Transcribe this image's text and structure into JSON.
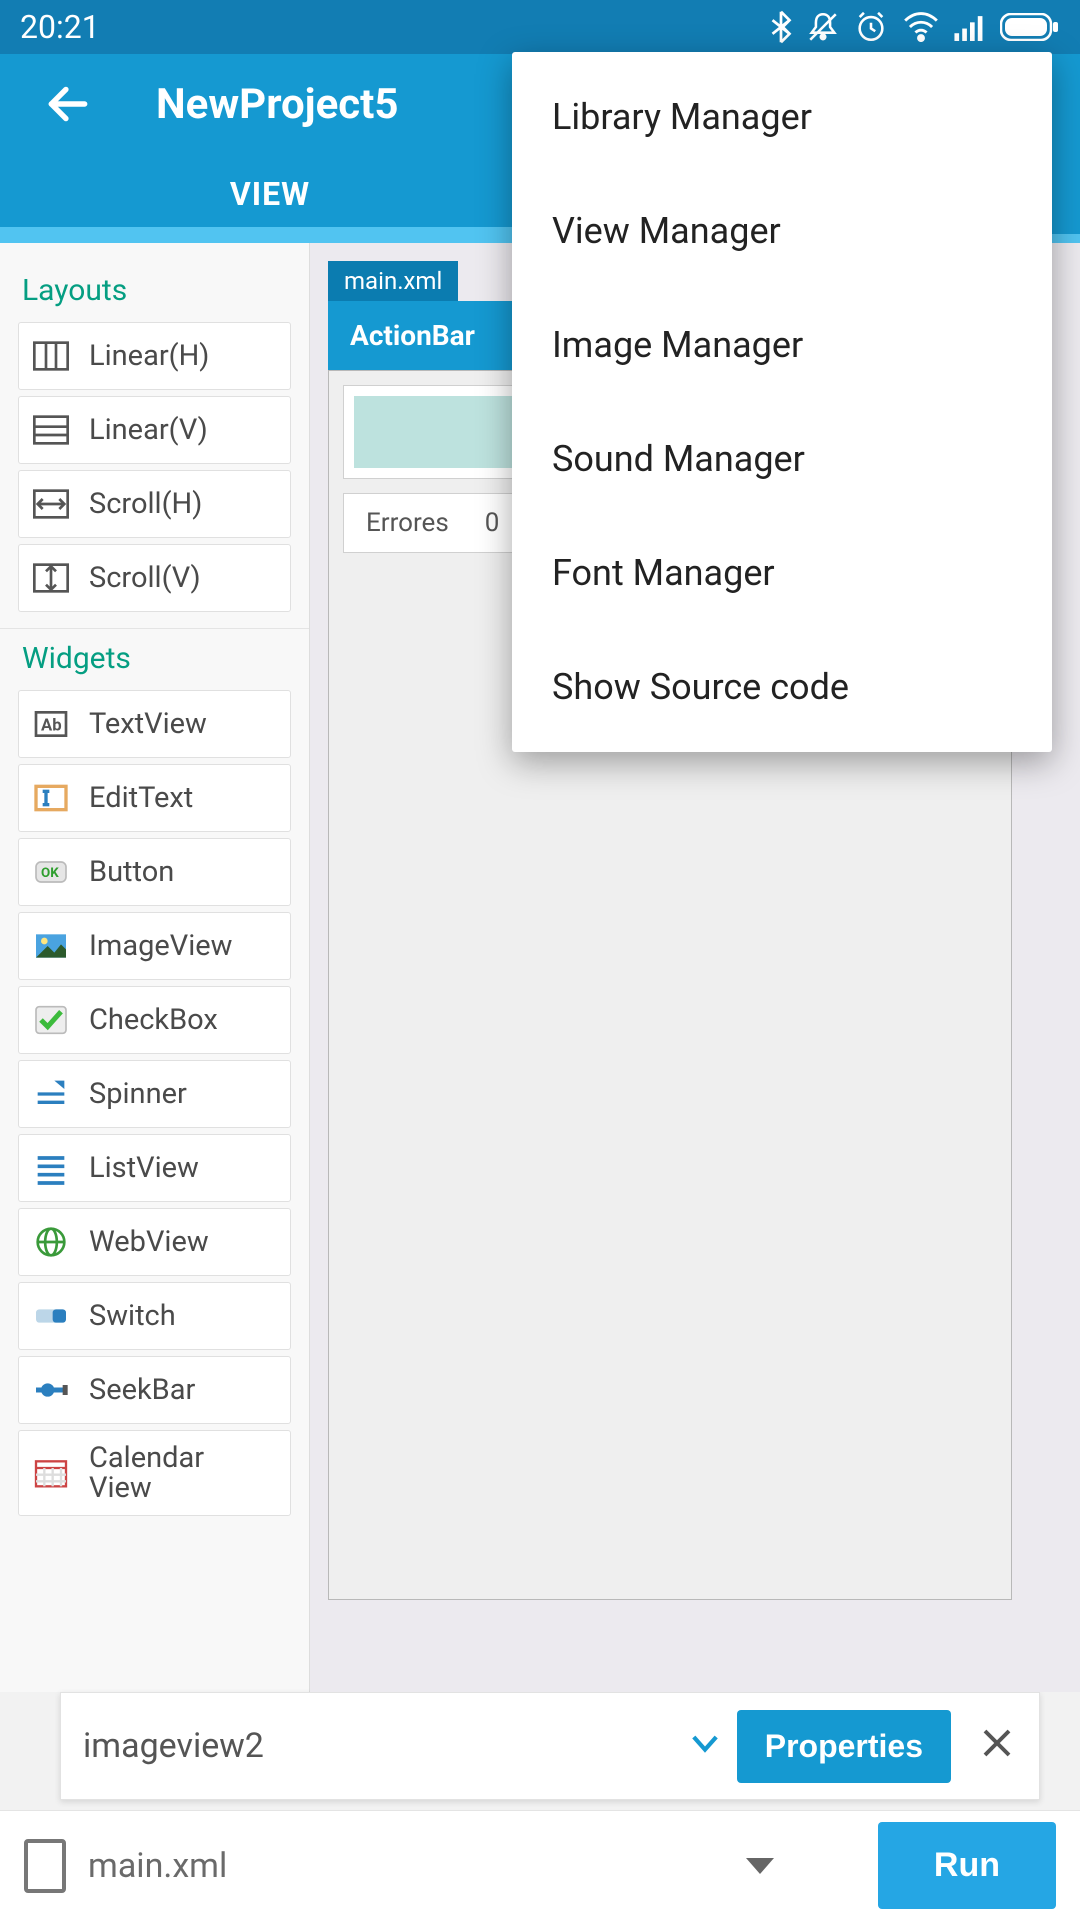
{
  "status": {
    "time": "20:21"
  },
  "appbar": {
    "title": "NewProject5"
  },
  "tabs": {
    "view": "VIEW"
  },
  "sidebar": {
    "layouts_header": "Layouts",
    "widgets_header": "Widgets",
    "layouts": {
      "linear_h": "Linear(H)",
      "linear_v": "Linear(V)",
      "scroll_h": "Scroll(H)",
      "scroll_v": "Scroll(V)"
    },
    "widgets": {
      "textview": "TextView",
      "edittext": "EditText",
      "button": "Button",
      "imageview": "ImageView",
      "checkbox": "CheckBox",
      "spinner": "Spinner",
      "listview": "ListView",
      "webview": "WebView",
      "switch": "Switch",
      "seekbar": "SeekBar",
      "calendarview": "Calendar\nView"
    }
  },
  "canvas": {
    "file_tab": "main.xml",
    "actionbar": "ActionBar",
    "errores_label": "Errores",
    "errores_count": "0"
  },
  "selbar": {
    "selected": "imageview2",
    "properties": "Properties"
  },
  "runbar": {
    "file": "main.xml",
    "run": "Run"
  },
  "menu": {
    "library": "Library Manager",
    "view": "View Manager",
    "image": "Image Manager",
    "sound": "Sound Manager",
    "font": "Font Manager",
    "source": "Show Source code"
  }
}
